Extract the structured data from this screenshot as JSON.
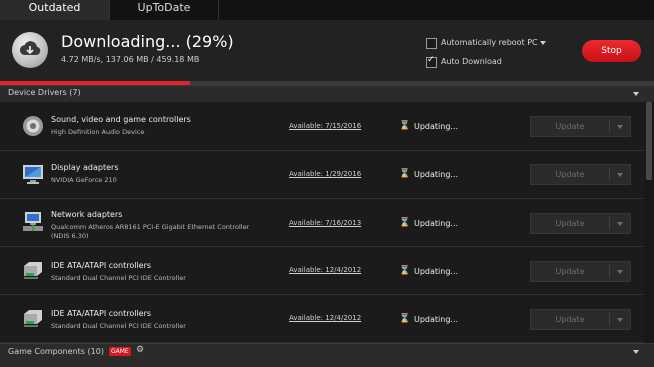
{
  "tabs": [
    {
      "label": "Outdated",
      "active": true
    },
    {
      "label": "UpToDate",
      "active": false
    }
  ],
  "header": {
    "title": "Downloading... (29%)",
    "stats": "4.72 MB/s, 137.06 MB / 459.18 MB",
    "progress": 0.29,
    "auto_reboot_label": "Automatically reboot PC",
    "auto_reboot_checked": false,
    "auto_download_label": "Auto Download",
    "auto_download_checked": true,
    "stop_label": "Stop"
  },
  "sections": {
    "drivers_title": "Device Drivers (7)",
    "game_title": "Game Components (10)",
    "game_badge": "GAME"
  },
  "rows": [
    {
      "name": "Sound, video and game controllers",
      "sub": "High Definition Audio Device",
      "available": "Available: 7/15/2016",
      "status": "Updating...",
      "button": "Update",
      "icon": "speaker-icon"
    },
    {
      "name": "Display adapters",
      "sub": "NVIDIA GeForce 210",
      "available": "Available: 1/29/2016",
      "status": "Updating...",
      "button": "Update",
      "icon": "monitor-icon"
    },
    {
      "name": "Network adapters",
      "sub": "Qualcomm Atheros AR8161 PCI-E Gigabit Ethernet Controller",
      "sub2": "(NDIS 6.30)",
      "available": "Available: 7/16/2013",
      "status": "Updating...",
      "button": "Update",
      "icon": "network-icon"
    },
    {
      "name": "IDE ATA/ATAPI controllers",
      "sub": "Standard Dual Channel PCI IDE Controller",
      "available": "Available: 12/4/2012",
      "status": "Updating...",
      "button": "Update",
      "icon": "drive-icon"
    },
    {
      "name": "IDE ATA/ATAPI controllers",
      "sub": "Standard Dual Channel PCI IDE Controller",
      "available": "Available: 12/4/2012",
      "status": "Updating...",
      "button": "Update",
      "icon": "drive-icon"
    }
  ],
  "colors": {
    "accent": "#e0262b",
    "stop_button": "#d8171d",
    "background": "#1b1b1b"
  }
}
